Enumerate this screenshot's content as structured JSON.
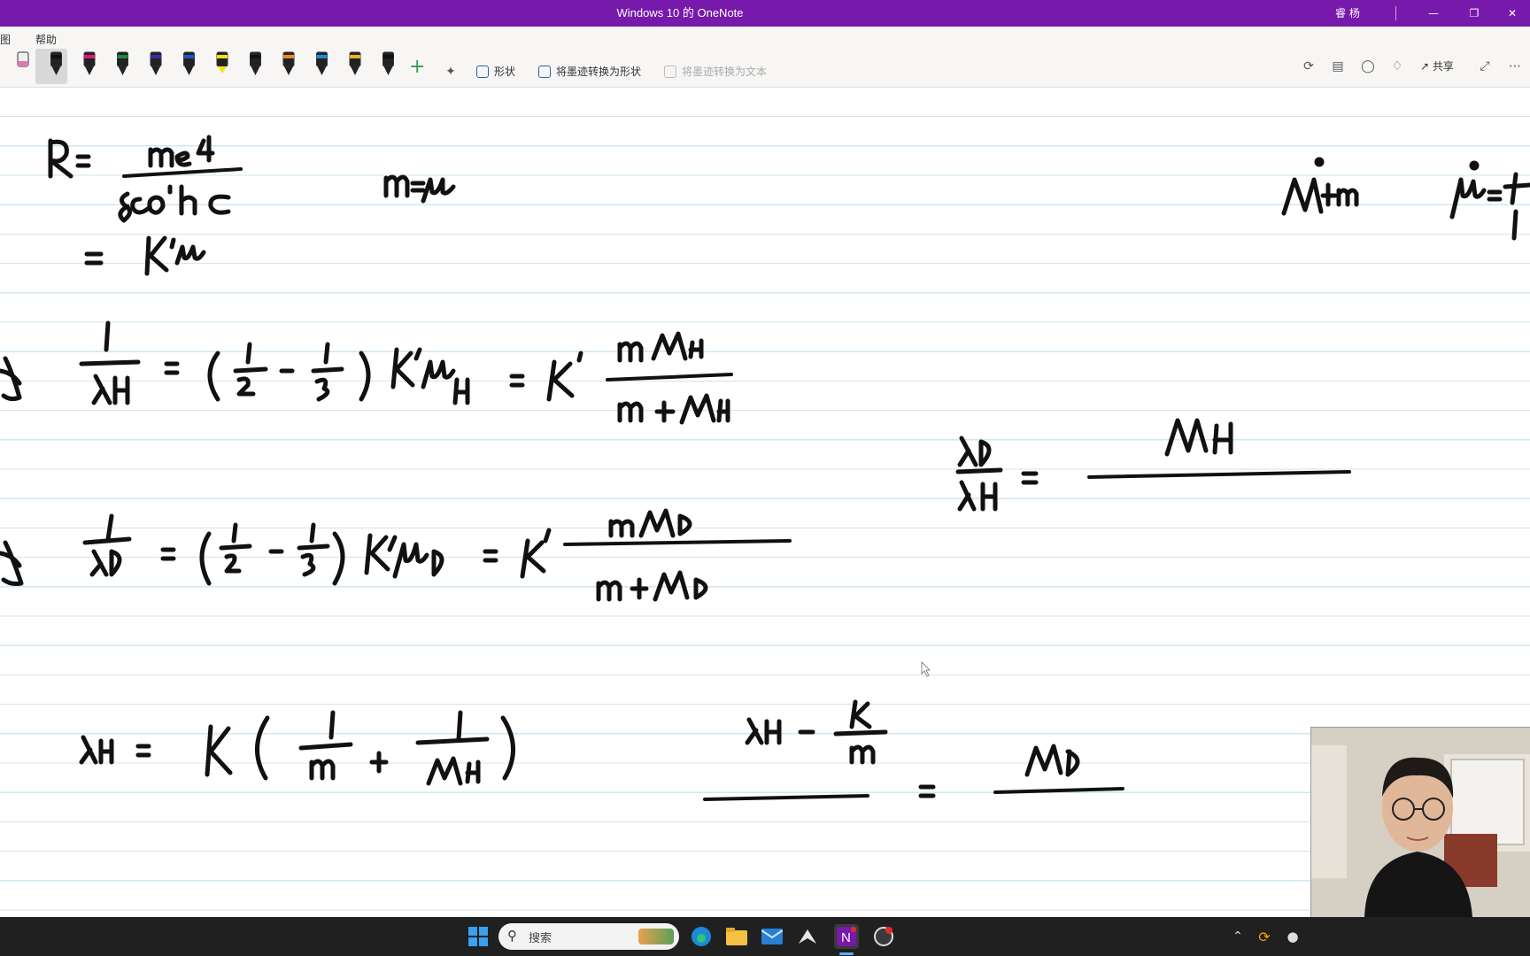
{
  "window": {
    "title": "Windows 10 的 OneNote",
    "user": "睿 杨"
  },
  "ribbon": {
    "tabs": [
      {
        "label": "图"
      },
      {
        "label": "帮助"
      }
    ],
    "share_label": "共享",
    "shapes_label": "形状",
    "ink_to_shape_label": "将墨迹转换为形状",
    "ink_to_text_label": "将墨迹转换为文本",
    "pens": [
      {
        "icon": "eraser-icon",
        "color": "#d97ab3"
      },
      {
        "icon": "pen-icon",
        "color": "#111111"
      },
      {
        "icon": "pen-icon",
        "color": "#e0187a"
      },
      {
        "icon": "pen-icon",
        "color": "#1f8a3a"
      },
      {
        "icon": "pen-icon",
        "color": "#3b2aa8"
      },
      {
        "icon": "pen-icon",
        "color": "#1e56c8"
      },
      {
        "icon": "highlighter-icon",
        "color": "#f2e30a"
      },
      {
        "icon": "pen-icon",
        "color": "#111111"
      },
      {
        "icon": "pen-icon",
        "color": "#f08a1a"
      },
      {
        "icon": "pen-icon",
        "color": "#1a8fd6"
      },
      {
        "icon": "pen-icon",
        "color": "#e8b71a"
      },
      {
        "icon": "pen-icon",
        "color": "#111111"
      }
    ]
  },
  "taskbar": {
    "search_placeholder": "搜索"
  },
  "colors": {
    "accent": "#7719aa",
    "ink": "#111111",
    "rule_line": "#cfe6f3"
  }
}
